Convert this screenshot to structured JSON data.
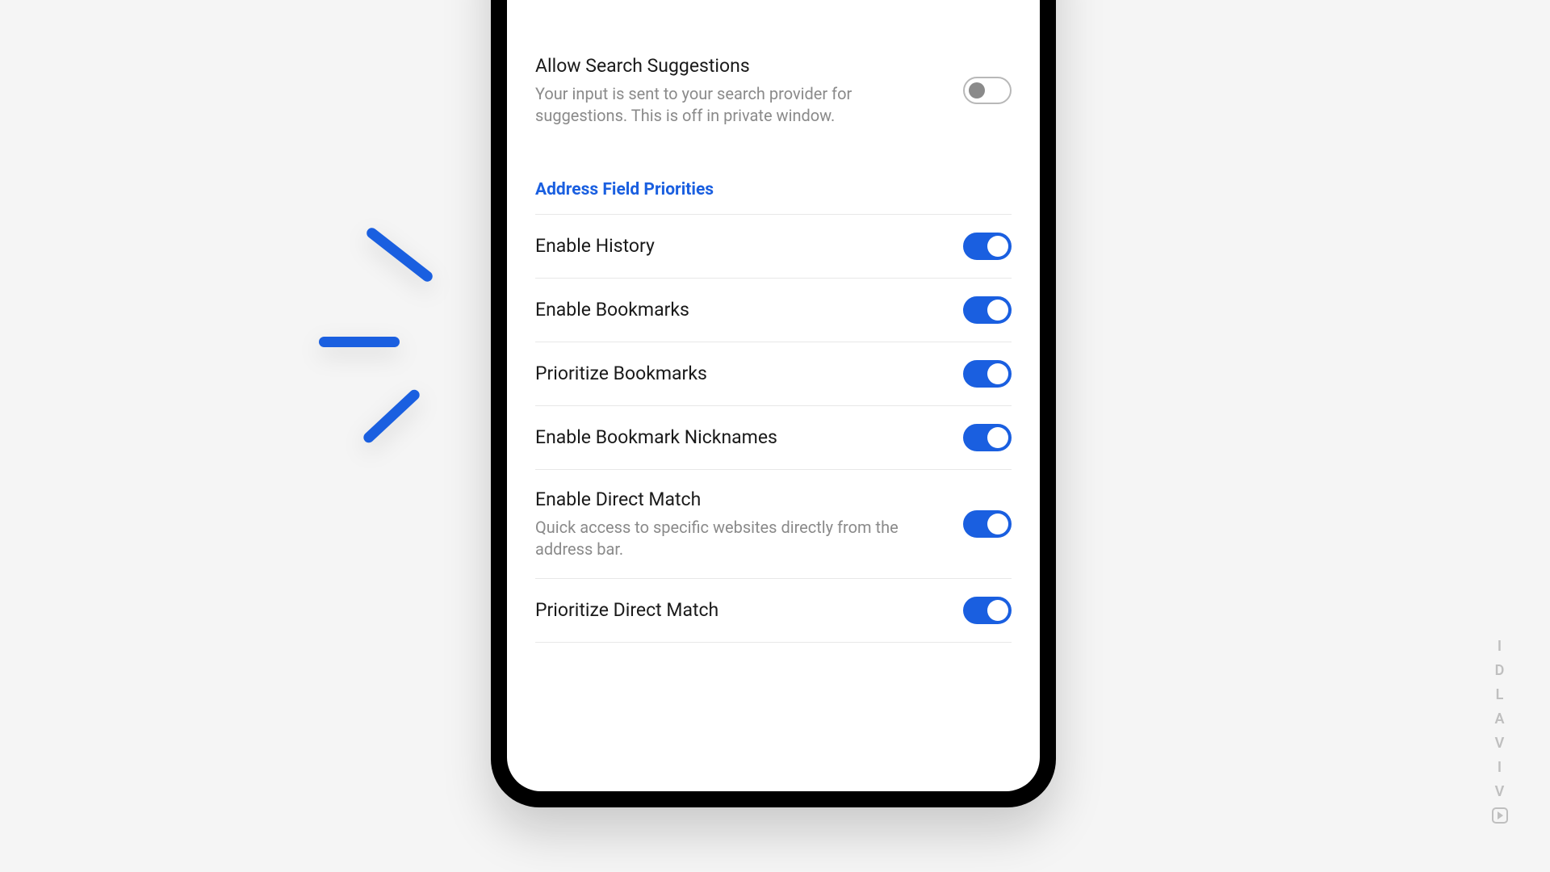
{
  "search_suggestions": {
    "title": "Allow Search Suggestions",
    "desc": "Your input is sent to your search provider for suggestions. This is off in private window.",
    "enabled": false
  },
  "section_header": "Address Field Priorities",
  "priorities": [
    {
      "title": "Enable History",
      "desc": "",
      "enabled": true
    },
    {
      "title": "Enable Bookmarks",
      "desc": "",
      "enabled": true
    },
    {
      "title": "Prioritize Bookmarks",
      "desc": "",
      "enabled": true
    },
    {
      "title": "Enable Bookmark Nicknames",
      "desc": "",
      "enabled": true
    },
    {
      "title": "Enable Direct Match",
      "desc": "Quick access to specific websites directly from the address bar.",
      "enabled": true
    },
    {
      "title": "Prioritize Direct Match",
      "desc": "",
      "enabled": true
    }
  ],
  "brand": {
    "letters": [
      "I",
      "D",
      "L",
      "A",
      "V",
      "I",
      "V"
    ]
  }
}
